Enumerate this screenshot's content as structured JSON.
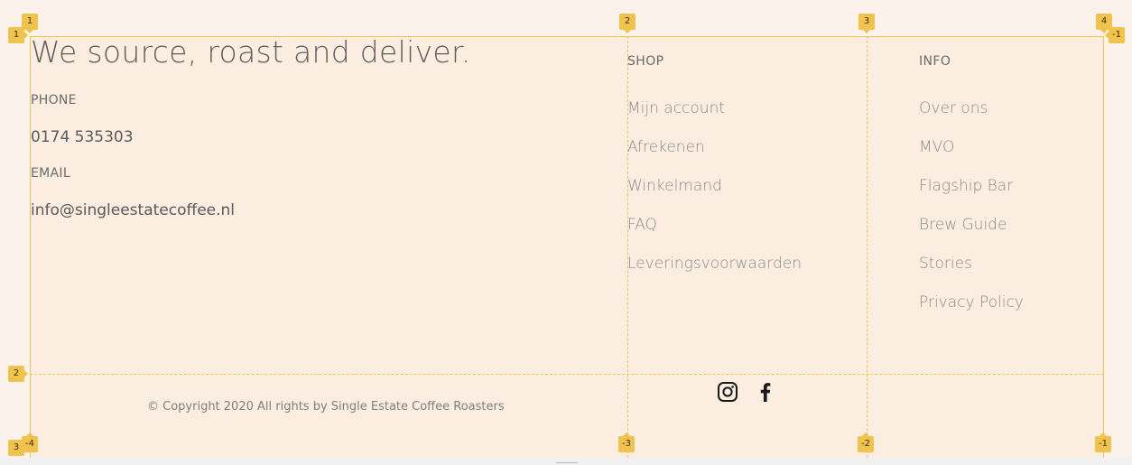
{
  "footer": {
    "tagline": "We source, roast and deliver.",
    "contact": {
      "phone_label": "PHONE",
      "phone_value": "0174 535303",
      "email_label": "EMAIL",
      "email_value": "info@singleestatecoffee.nl"
    },
    "shop": {
      "title": "SHOP",
      "items": [
        {
          "label": "Mijn account"
        },
        {
          "label": "Afrekenen"
        },
        {
          "label": "Winkelmand"
        },
        {
          "label": "FAQ"
        },
        {
          "label": "Leveringsvoorwaarden"
        }
      ]
    },
    "info": {
      "title": "INFO",
      "items": [
        {
          "label": "Over ons"
        },
        {
          "label": "MVO"
        },
        {
          "label": "Flagship Bar"
        },
        {
          "label": "Brew Guide"
        },
        {
          "label": "Stories"
        },
        {
          "label": "Privacy Policy"
        }
      ]
    },
    "copyright": "© Copyright 2020 All rights by Single Estate Coffee Roasters",
    "social": [
      {
        "icon": "instagram-icon"
      },
      {
        "icon": "facebook-icon"
      }
    ]
  },
  "grid_overlay": {
    "color": "#f0c44c",
    "column_labels_top": [
      "1",
      "2",
      "3",
      "4"
    ],
    "column_labels_bottom": [
      "-4",
      "-3",
      "-2",
      "-1"
    ],
    "row_labels_left": [
      "1",
      "2",
      "3"
    ],
    "row_label_right": "-1"
  },
  "colors": {
    "page_background": "#fbf2ec",
    "grid_background": "#fbede0",
    "text_dark": "#5f5f5f",
    "text_link": "#8a8a8a"
  }
}
